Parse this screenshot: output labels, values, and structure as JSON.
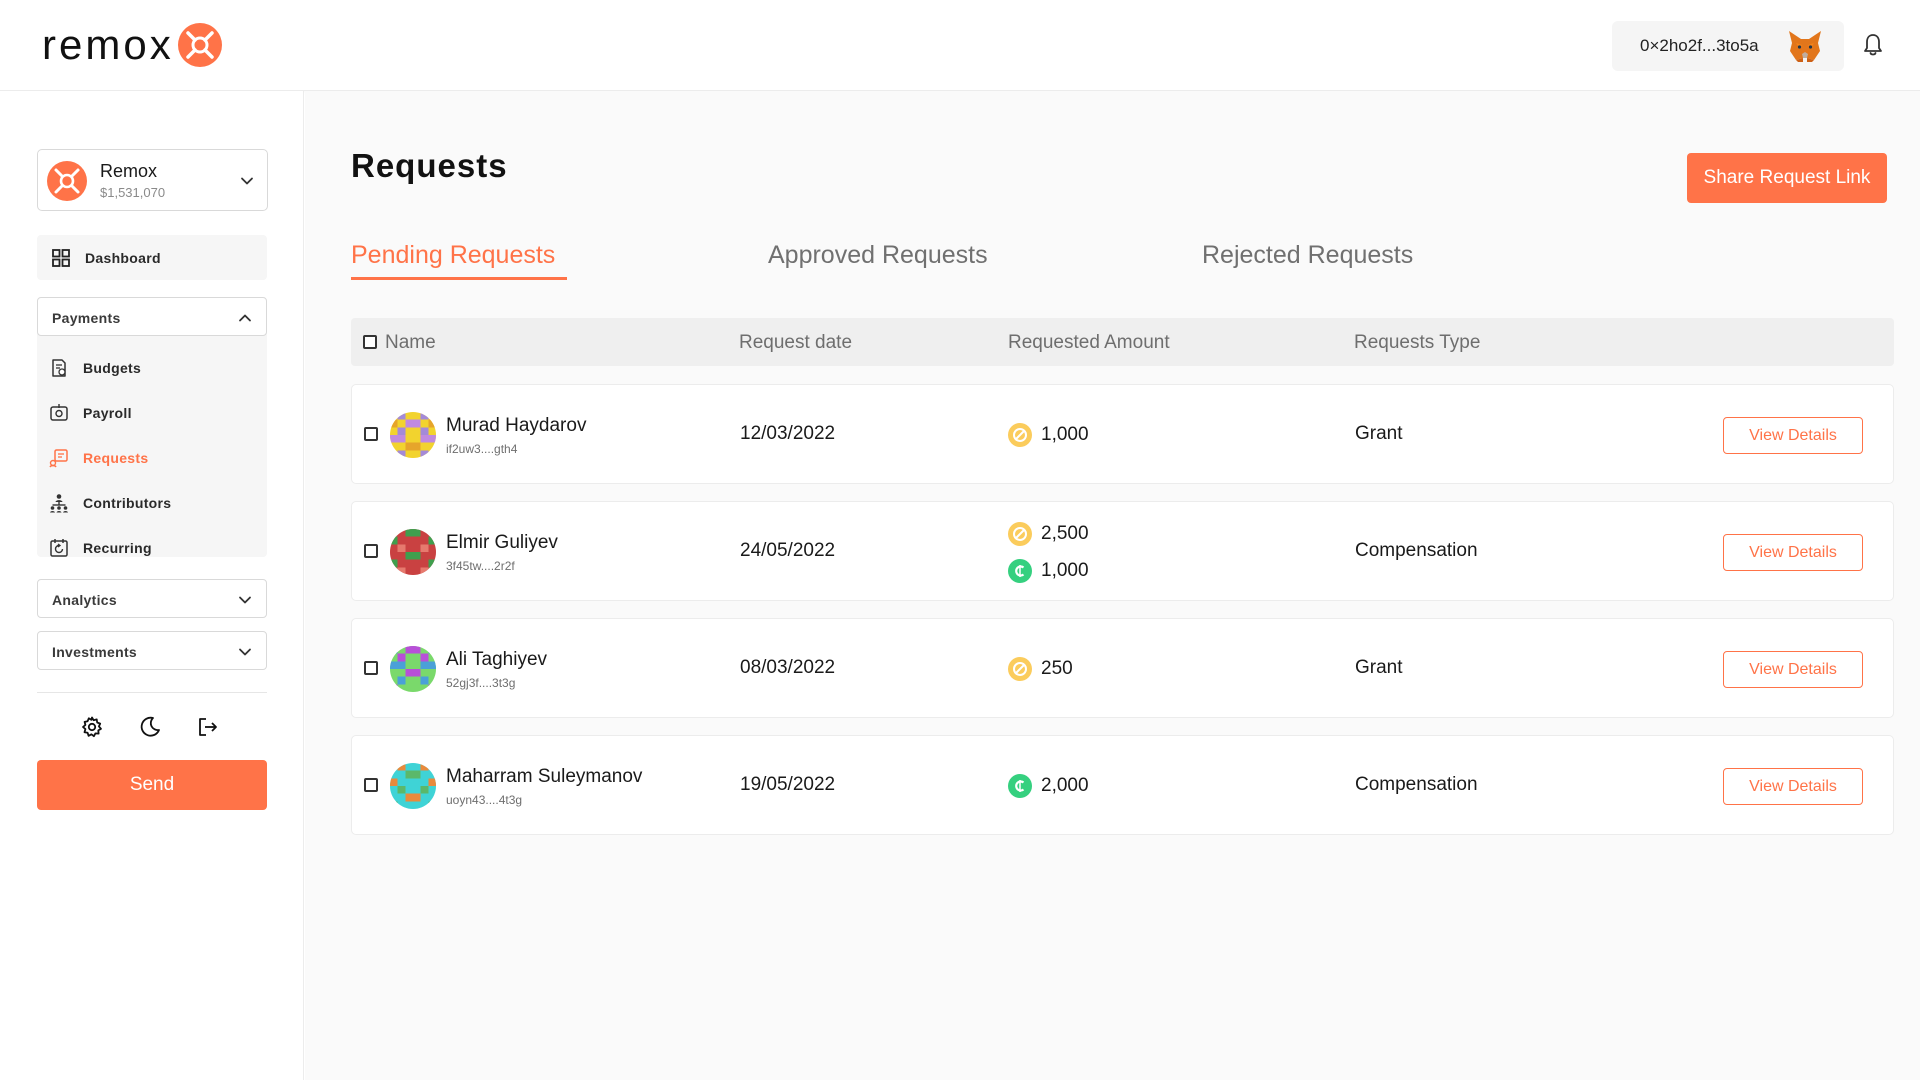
{
  "brand": {
    "name": "remox",
    "accent": "#ff7348"
  },
  "header": {
    "wallet_address": "0×2ho2f...3to5a"
  },
  "account": {
    "name": "Remox",
    "balance": "$1,531,070"
  },
  "sidebar": {
    "dashboard": "Dashboard",
    "payments": {
      "label": "Payments",
      "items": [
        {
          "label": "Budgets",
          "icon": "budgets-icon"
        },
        {
          "label": "Payroll",
          "icon": "payroll-icon"
        },
        {
          "label": "Requests",
          "icon": "requests-icon",
          "active": true
        },
        {
          "label": "Contributors",
          "icon": "contributors-icon"
        },
        {
          "label": "Recurring",
          "icon": "recurring-icon"
        }
      ]
    },
    "analytics": "Analytics",
    "investments": "Investments",
    "send_label": "Send"
  },
  "main": {
    "title": "Requests",
    "share_label": "Share Request Link",
    "tabs": [
      "Pending Requests",
      "Approved Requests",
      "Rejected Requests"
    ],
    "active_tab": 0,
    "columns": [
      "Name",
      "Request date",
      "Requested Amount",
      "Requests Type"
    ],
    "rows": [
      {
        "name": "Murad Haydarov",
        "address": "if2uw3....gth4",
        "date": "12/03/2022",
        "amounts": [
          {
            "coin": "yellow-coin",
            "value": "1,000"
          }
        ],
        "type": "Grant",
        "action": "View Details"
      },
      {
        "name": "Elmir Guliyev",
        "address": "3f45tw....2r2f",
        "date": "24/05/2022",
        "amounts": [
          {
            "coin": "yellow-coin",
            "value": "2,500"
          },
          {
            "coin": "green-coin",
            "value": "1,000"
          }
        ],
        "type": "Compensation",
        "action": "View Details"
      },
      {
        "name": "Ali Taghiyev",
        "address": "52gj3f....3t3g",
        "date": "08/03/2022",
        "amounts": [
          {
            "coin": "yellow-coin",
            "value": "250"
          }
        ],
        "type": "Grant",
        "action": "View Details"
      },
      {
        "name": "Maharram Suleymanov",
        "address": "uoyn43....4t3g",
        "date": "19/05/2022",
        "amounts": [
          {
            "coin": "green-coin",
            "value": "2,000"
          }
        ],
        "type": "Compensation",
        "action": "View Details"
      }
    ]
  }
}
